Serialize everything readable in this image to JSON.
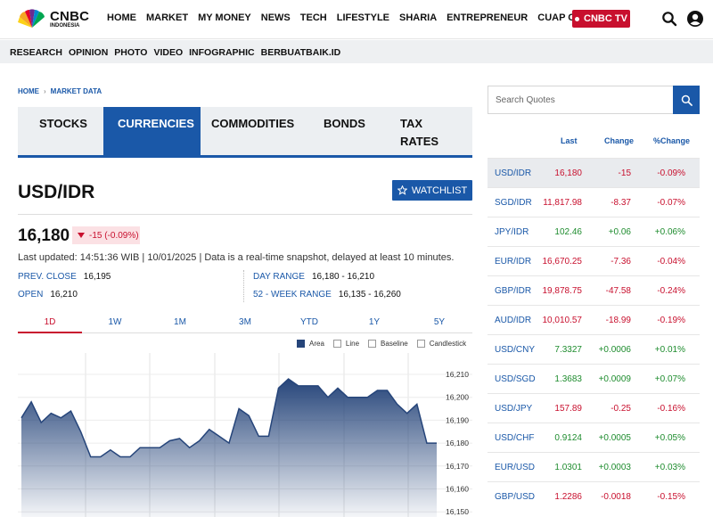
{
  "header": {
    "brand": "CNBC",
    "brand_sub": "INDONESIA",
    "menu": [
      "HOME",
      "MARKET",
      "MY MONEY",
      "NEWS",
      "TECH",
      "LIFESTYLE",
      "SHARIA",
      "ENTREPRENEUR",
      "CUAP CUAP CUAN"
    ],
    "tv_label": "CNBC TV",
    "subnav": [
      "RESEARCH",
      "OPINION",
      "PHOTO",
      "VIDEO",
      "INFOGRAPHIC",
      "BERBUATBAIK.ID"
    ]
  },
  "breadcrumb": {
    "home": "HOME",
    "separator": "›",
    "current": "MARKET DATA"
  },
  "tabs": [
    {
      "label": "STOCKS",
      "active": false
    },
    {
      "label": "CURRENCIES",
      "active": true
    },
    {
      "label": "COMMODITIES",
      "active": false
    },
    {
      "label": "BONDS",
      "active": false
    },
    {
      "label": "TAX RATES",
      "active": false
    }
  ],
  "quote": {
    "symbol": "USD/IDR",
    "watchlist_label": "WATCHLIST",
    "price": "16,180",
    "change": "-15 (-0.09%)",
    "updated": "Last updated: 14:51:36 WIB | 10/01/2025 | Data is a real-time snapshot, delayed at least 10 minutes.",
    "prev_close_label": "PREV. CLOSE",
    "prev_close": "16,195",
    "open_label": "OPEN",
    "open": "16,210",
    "day_range_label": "DAY RANGE",
    "day_range": "16,180 - 16,210",
    "week52_label": "52 - WEEK RANGE",
    "week52": "16,135 - 16,260"
  },
  "ranges": [
    "1D",
    "1W",
    "1M",
    "3M",
    "YTD",
    "1Y",
    "5Y"
  ],
  "active_range": "1D",
  "chart_legend": [
    "Area",
    "Line",
    "Baseline",
    "Candlestick"
  ],
  "chart_data": {
    "type": "area",
    "y_ticks": [
      "16,210",
      "16,200",
      "16,190",
      "16,180",
      "16,170",
      "16,160",
      "16,150"
    ],
    "ylim": [
      16150,
      16210
    ],
    "values": [
      16191,
      16198,
      16189,
      16193,
      16191,
      16194,
      16185,
      16174,
      16174,
      16177,
      16174,
      16174,
      16178,
      16178,
      16178,
      16181,
      16182,
      16178,
      16181,
      16186,
      16183,
      16180,
      16195,
      16192,
      16183,
      16183,
      16204,
      16208,
      16205,
      16205,
      16205,
      16200,
      16204,
      16200,
      16200,
      16200,
      16203,
      16203,
      16197,
      16193,
      16197,
      16180,
      16180
    ],
    "area_color": "#26457a",
    "grid": true
  },
  "search": {
    "placeholder": "Search Quotes"
  },
  "quotes_table": {
    "headers": [
      "Last",
      "Change",
      "%Change"
    ],
    "rows": [
      {
        "symbol": "USD/IDR",
        "last": "16,180",
        "change": "-15",
        "pct": "-0.09%",
        "dir": "down",
        "highlight": true
      },
      {
        "symbol": "SGD/IDR",
        "last": "11,817.98",
        "change": "-8.37",
        "pct": "-0.07%",
        "dir": "down"
      },
      {
        "symbol": "JPY/IDR",
        "last": "102.46",
        "change": "+0.06",
        "pct": "+0.06%",
        "dir": "up"
      },
      {
        "symbol": "EUR/IDR",
        "last": "16,670.25",
        "change": "-7.36",
        "pct": "-0.04%",
        "dir": "down"
      },
      {
        "symbol": "GBP/IDR",
        "last": "19,878.75",
        "change": "-47.58",
        "pct": "-0.24%",
        "dir": "down"
      },
      {
        "symbol": "AUD/IDR",
        "last": "10,010.57",
        "change": "-18.99",
        "pct": "-0.19%",
        "dir": "down"
      },
      {
        "symbol": "USD/CNY",
        "last": "7.3327",
        "change": "+0.0006",
        "pct": "+0.01%",
        "dir": "up"
      },
      {
        "symbol": "USD/SGD",
        "last": "1.3683",
        "change": "+0.0009",
        "pct": "+0.07%",
        "dir": "up"
      },
      {
        "symbol": "USD/JPY",
        "last": "157.89",
        "change": "-0.25",
        "pct": "-0.16%",
        "dir": "down"
      },
      {
        "symbol": "USD/CHF",
        "last": "0.9124",
        "change": "+0.0005",
        "pct": "+0.05%",
        "dir": "up"
      },
      {
        "symbol": "EUR/USD",
        "last": "1.0301",
        "change": "+0.0003",
        "pct": "+0.03%",
        "dir": "up"
      },
      {
        "symbol": "GBP/USD",
        "last": "1.2286",
        "change": "-0.0018",
        "pct": "-0.15%",
        "dir": "down"
      }
    ]
  },
  "colors": {
    "accent": "#1a58a8",
    "up": "#1e8c2e",
    "down": "#c8102e",
    "brand_red": "#c8102e"
  }
}
